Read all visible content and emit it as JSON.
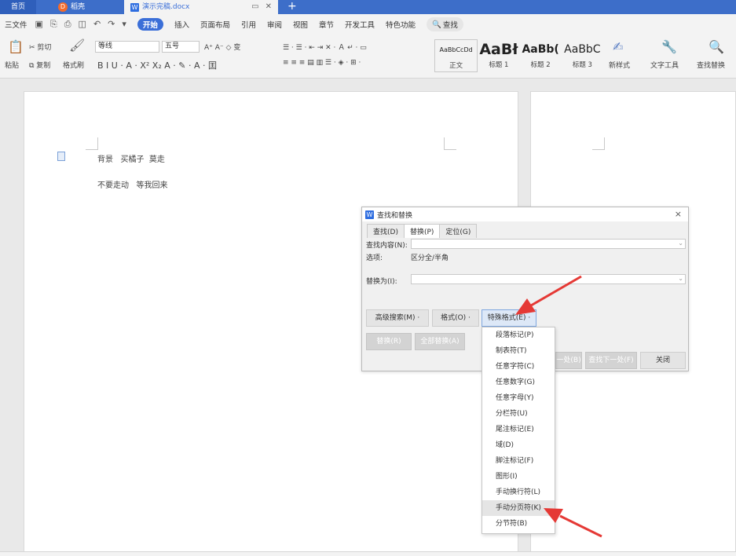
{
  "tabs": {
    "home": "首页",
    "daoke": "稻壳",
    "document": "演示完稿.docx",
    "new_tab": "+"
  },
  "menubar": {
    "file": "三文件",
    "items": [
      "开始",
      "插入",
      "页面布局",
      "引用",
      "审阅",
      "视图",
      "章节",
      "开发工具",
      "特色功能"
    ],
    "search": "查找"
  },
  "ribbon": {
    "paste": "粘贴",
    "cut": "剪切",
    "copy": "复制",
    "format_painter": "格式刷",
    "font_name": "等线",
    "font_size": "五号",
    "styles": [
      {
        "preview": "AaBbCcDd",
        "name": "正文"
      },
      {
        "preview": "AaBł",
        "name": "标题 1"
      },
      {
        "preview": "AaBb(",
        "name": "标题 2"
      },
      {
        "preview": "AaBbC",
        "name": "标题 3"
      }
    ],
    "new_style": "新样式",
    "text_tools": "文字工具",
    "find_replace": "查找替换"
  },
  "document": {
    "line1": "背景   买橘子  莫走",
    "line2": "不要走动   等我回来"
  },
  "dialog": {
    "title": "查找和替换",
    "close": "×",
    "tabs": [
      "查找(D)",
      "替换(P)",
      "定位(G)"
    ],
    "find_label": "查找内容(N):",
    "options_label": "选项:",
    "options_value": "区分全/半角",
    "replace_label": "替换为(I):",
    "btn_advanced": "高级搜索(M)",
    "btn_format": "格式(O)",
    "btn_special": "特殊格式(E)",
    "btn_replace": "替换(R)",
    "btn_replace_all": "全部替换(A)",
    "btn_find_prev": "一处(B)",
    "btn_find_next": "查找下一处(F)",
    "btn_close": "关闭"
  },
  "special_menu": [
    "段落标记(P)",
    "制表符(T)",
    "任意字符(C)",
    "任意数字(G)",
    "任意字母(Y)",
    "分栏符(U)",
    "尾注标记(E)",
    "域(D)",
    "脚注标记(F)",
    "图形(I)",
    "手动换行符(L)",
    "手动分页符(K)",
    "分节符(B)"
  ],
  "colors": {
    "accent": "#3b6fd8",
    "tabbar": "#3d6ec9",
    "arrow": "#e53935"
  }
}
